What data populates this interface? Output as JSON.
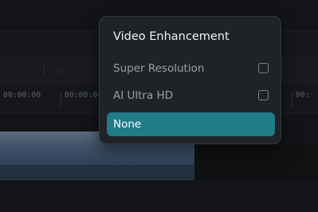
{
  "timeline": {
    "timecodes": [
      "00:00:00",
      "00:00:04",
      "00:00:08",
      "00:"
    ]
  },
  "menu": {
    "title": "Video Enhancement",
    "options": [
      {
        "label": "Super Resolution",
        "checked": false
      },
      {
        "label": "AI Ultra HD",
        "checked": false
      },
      {
        "label": "None",
        "selected": true
      }
    ]
  },
  "colors": {
    "accent": "#1f7c88",
    "menu_bg": "#1f2226",
    "app_bg": "#141619"
  }
}
